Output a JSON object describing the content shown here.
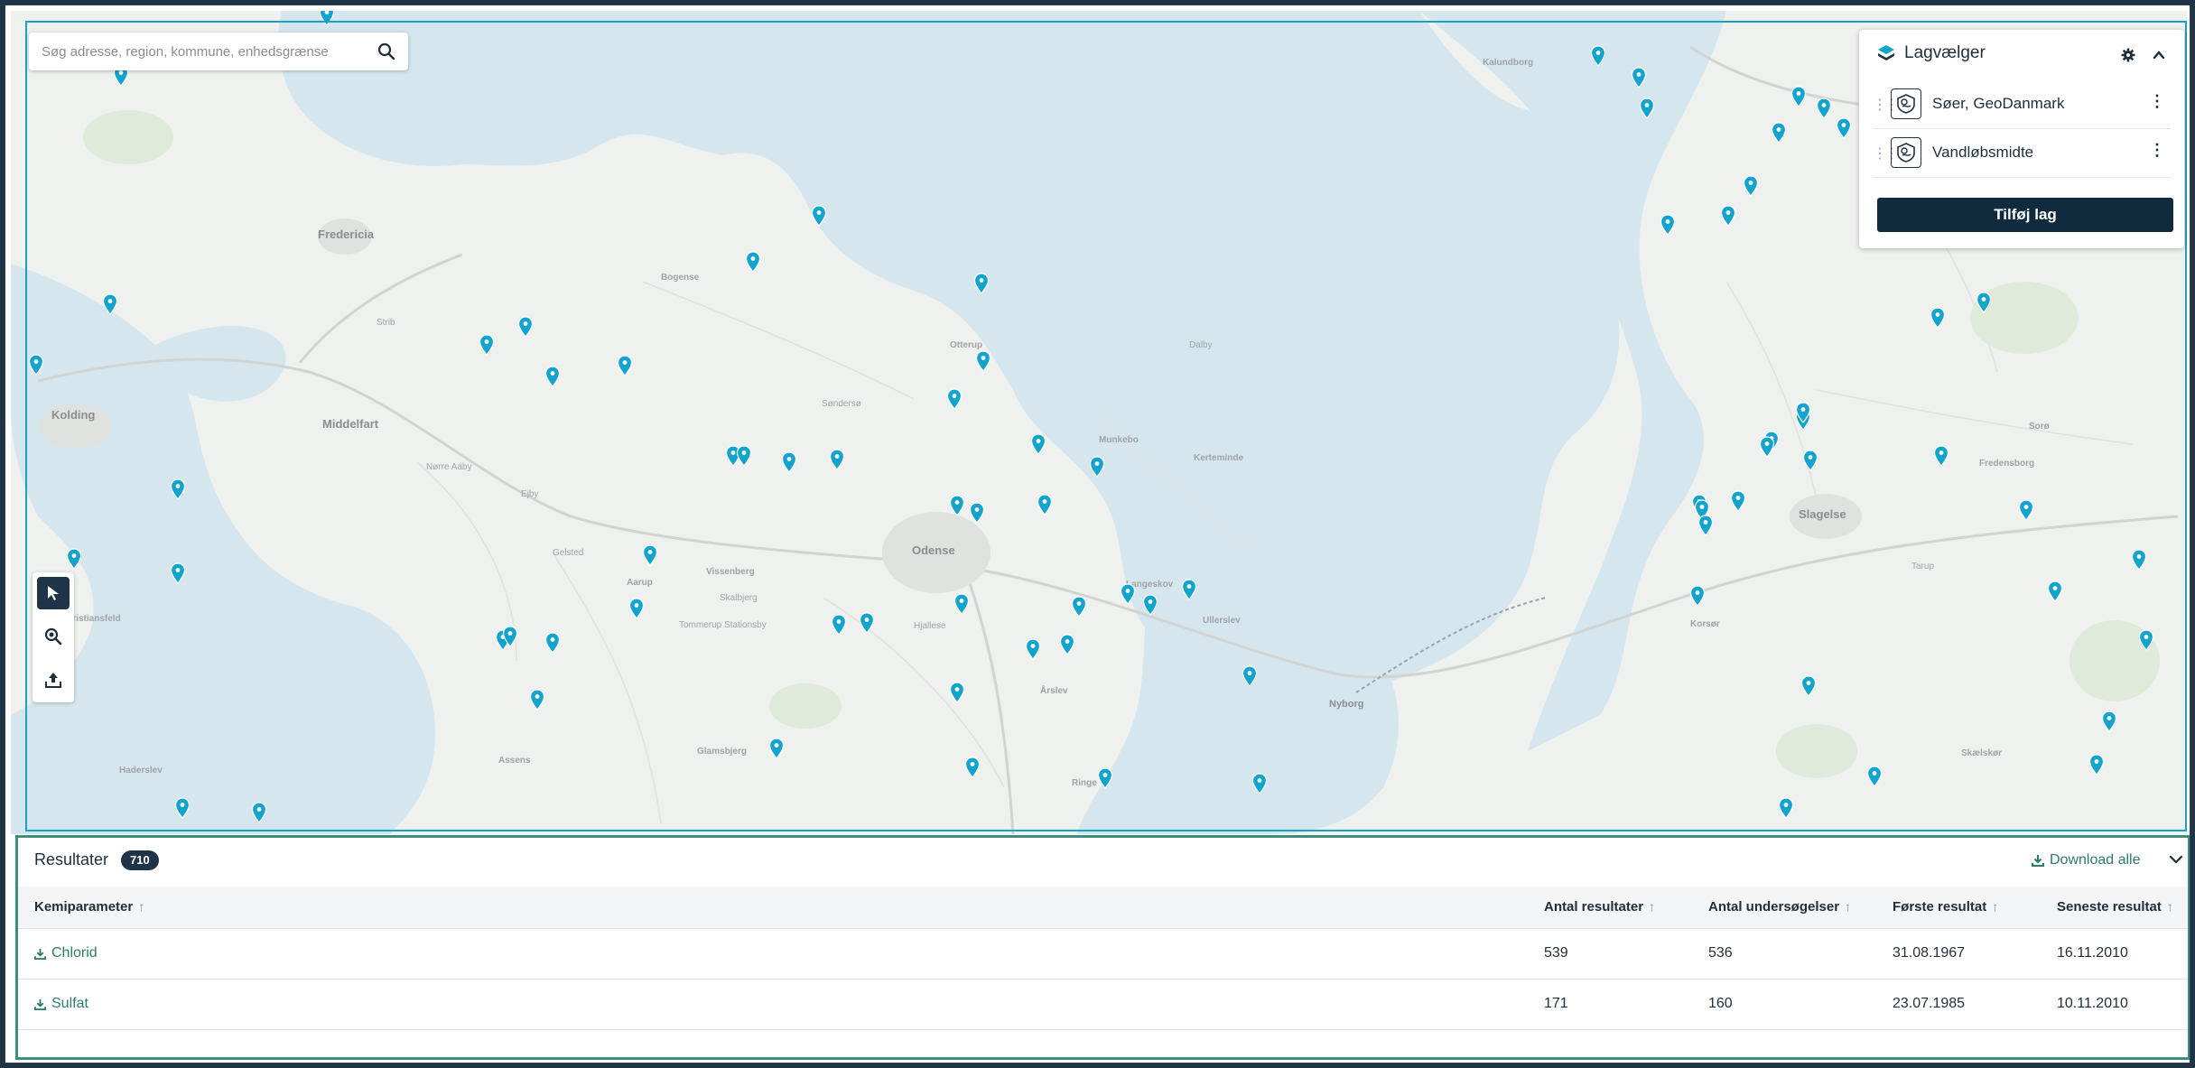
{
  "search": {
    "placeholder": "Søg adresse, region, kommune, enhedsgrænse"
  },
  "map": {
    "water_color": "#d6e6ef",
    "land_color": "#eef1ee",
    "pin_color": "#12a4cd",
    "place_labels": [
      "Fredericia",
      "Kolding",
      "Middelfart",
      "Odense",
      "Nyborg",
      "Slagelse",
      "Korsør",
      "Kalundborg",
      "Assens",
      "Haderslev",
      "Christiansfeld",
      "Bogense",
      "Otterup",
      "Munkebo",
      "Kerteminde",
      "Langeskov",
      "Ullerslev",
      "Årslev",
      "Ringe",
      "Glamsbjerg",
      "Vissenberg",
      "Aarup",
      "Sorø",
      "Fredensborg",
      "Skælskør",
      "Strib",
      "Søndersø",
      "Tommerup Stationsby",
      "Dalby",
      "Hjallese",
      "Nørre Aaby",
      "Ejby",
      "Gelsted",
      "Skalbjerg",
      "Tarup"
    ]
  },
  "tools": {
    "select": "cursor-icon",
    "zoom": "zoom-icon",
    "upload": "upload-icon"
  },
  "layer_panel": {
    "title": "Lagvælger",
    "layers": [
      {
        "name": "Søer, GeoDanmark"
      },
      {
        "name": "Vandløbsmidte"
      }
    ],
    "add_button": "Tilføj lag"
  },
  "results": {
    "title": "Resultater",
    "count": "710",
    "download_all": "Download alle",
    "columns": [
      "Kemiparameter",
      "Antal resultater",
      "Antal undersøgelser",
      "Første resultat",
      "Seneste resultat"
    ],
    "rows": [
      {
        "parameter": "Chlorid",
        "antal_resultater": "539",
        "antal_undersoegelser": "536",
        "foerste": "31.08.1967",
        "seneste": "16.11.2010"
      },
      {
        "parameter": "Sulfat",
        "antal_resultater": "171",
        "antal_undersoegelser": "160",
        "foerste": "23.07.1985",
        "seneste": "10.11.2010"
      }
    ]
  },
  "colors": {
    "accent_dark": "#1f3446",
    "accent_green": "#2c7d68",
    "results_border": "#3c8f7a",
    "map_outline": "#1aa0c6"
  }
}
